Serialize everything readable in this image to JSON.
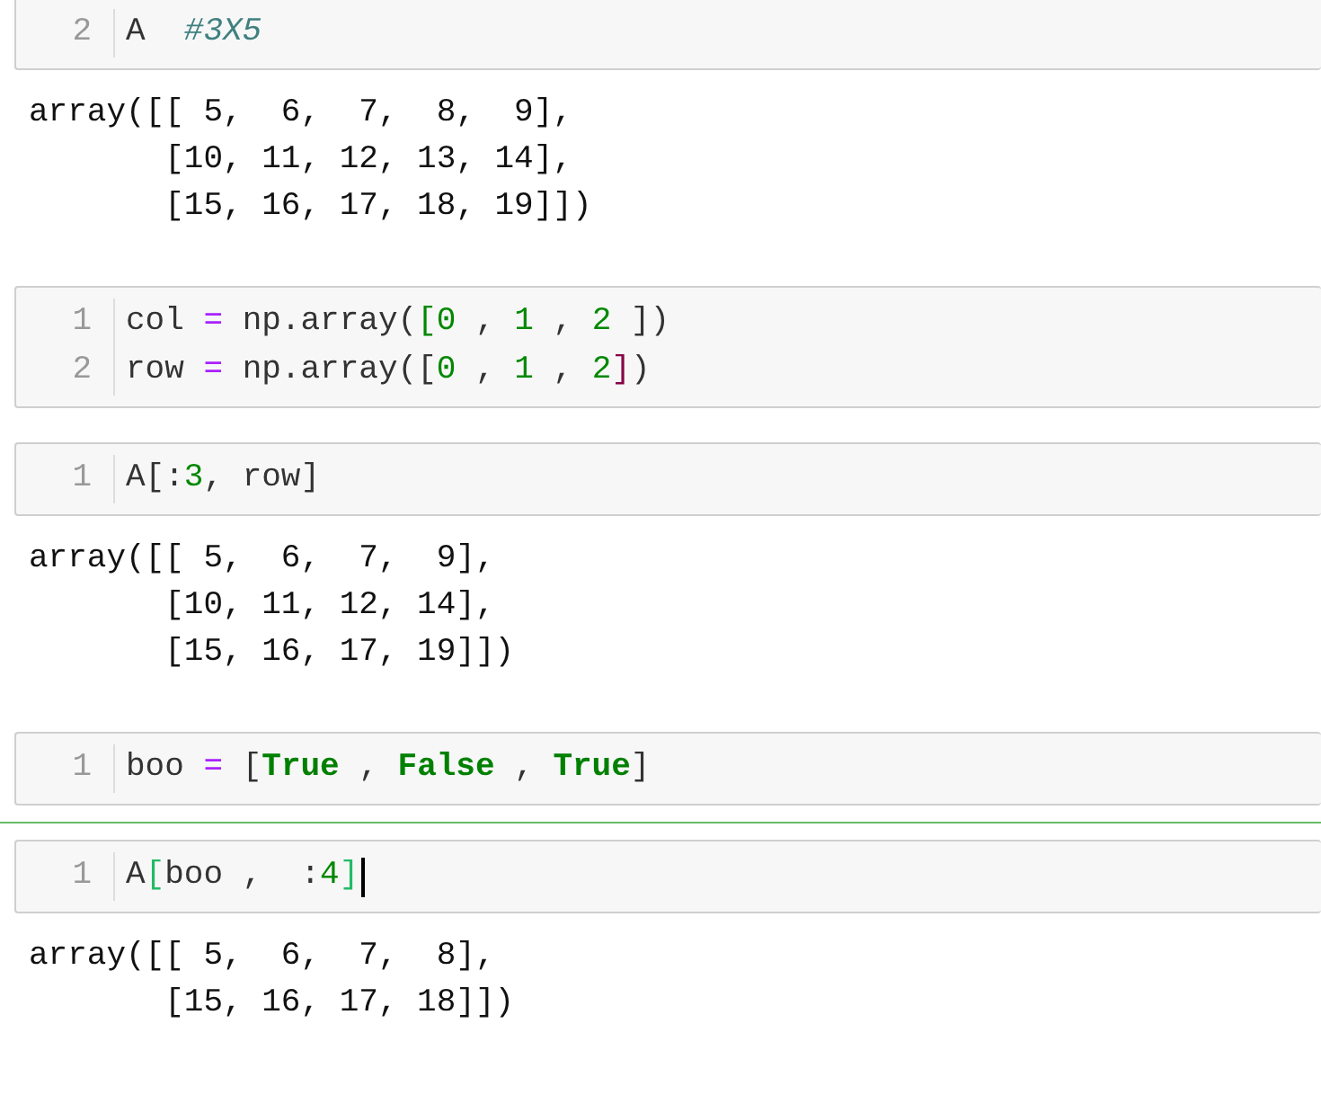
{
  "cells": [
    {
      "selected": false,
      "lines": [
        {
          "number": "2",
          "tokens": [
            {
              "kind": "plain",
              "text": "A  "
            },
            {
              "kind": "comment",
              "text": "#3X5"
            }
          ]
        }
      ],
      "output": [
        "array([[ 5,  6,  7,  8,  9],",
        "       [10, 11, 12, 13, 14],",
        "       [15, 16, 17, 18, 19]])"
      ]
    },
    {
      "selected": false,
      "lines": [
        {
          "number": "1",
          "tokens": [
            {
              "kind": "plain",
              "text": "col "
            },
            {
              "kind": "op",
              "text": "="
            },
            {
              "kind": "plain",
              "text": " np.array("
            },
            {
              "kind": "bracket",
              "text": "[",
              "color": "#008800"
            },
            {
              "kind": "num",
              "text": "0"
            },
            {
              "kind": "plain",
              "text": " , "
            },
            {
              "kind": "num",
              "text": "1"
            },
            {
              "kind": "plain",
              "text": " , "
            },
            {
              "kind": "num",
              "text": "2 "
            },
            {
              "kind": "bracket",
              "text": "]",
              "color": "#333333"
            },
            {
              "kind": "plain",
              "text": ")"
            }
          ]
        },
        {
          "number": "2",
          "tokens": [
            {
              "kind": "plain",
              "text": "row "
            },
            {
              "kind": "op",
              "text": "="
            },
            {
              "kind": "plain",
              "text": " np.array("
            },
            {
              "kind": "bracket",
              "text": "[",
              "color": "#333333"
            },
            {
              "kind": "num",
              "text": "0"
            },
            {
              "kind": "plain",
              "text": " , "
            },
            {
              "kind": "num",
              "text": "1"
            },
            {
              "kind": "plain",
              "text": " , "
            },
            {
              "kind": "num",
              "text": "2"
            },
            {
              "kind": "bracket",
              "text": "]",
              "color": "#880044"
            },
            {
              "kind": "plain",
              "text": ")"
            }
          ]
        }
      ]
    },
    {
      "selected": false,
      "lines": [
        {
          "number": "1",
          "tokens": [
            {
              "kind": "plain",
              "text": "A[:"
            },
            {
              "kind": "num",
              "text": "3"
            },
            {
              "kind": "plain",
              "text": ", row]"
            }
          ]
        }
      ],
      "output": [
        "array([[ 5,  6,  7,  9],",
        "       [10, 11, 12, 14],",
        "       [15, 16, 17, 19]])"
      ]
    },
    {
      "selected": false,
      "lines": [
        {
          "number": "1",
          "tokens": [
            {
              "kind": "plain",
              "text": "boo "
            },
            {
              "kind": "op",
              "text": "="
            },
            {
              "kind": "plain",
              "text": " ["
            },
            {
              "kind": "kw",
              "text": "True"
            },
            {
              "kind": "plain",
              "text": " , "
            },
            {
              "kind": "kw",
              "text": "False"
            },
            {
              "kind": "plain",
              "text": " , "
            },
            {
              "kind": "kw",
              "text": "True"
            },
            {
              "kind": "plain",
              "text": "]"
            }
          ]
        }
      ]
    },
    {
      "selected": true,
      "lines": [
        {
          "number": "1",
          "tokens": [
            {
              "kind": "plain",
              "text": "A"
            },
            {
              "kind": "bracket",
              "text": "[",
              "color": "#22bb66"
            },
            {
              "kind": "plain",
              "text": "boo ,  :"
            },
            {
              "kind": "num",
              "text": "4"
            },
            {
              "kind": "bracket",
              "text": "]",
              "color": "#22bb66"
            }
          ]
        }
      ],
      "output": [
        "array([[ 5,  6,  7,  8],",
        "       [15, 16, 17, 18]])"
      ]
    }
  ]
}
